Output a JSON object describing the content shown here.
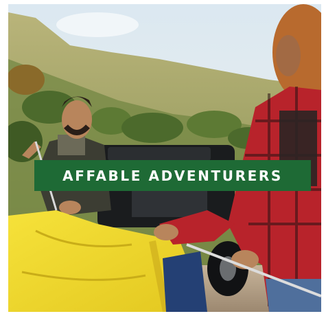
{
  "banner": {
    "label": "AFFABLE ADVENTURERS",
    "background": "#1e6a35",
    "text_color": "#ffffff"
  },
  "photo": {
    "subject": "friends-unpacking-camping-gear",
    "colors": {
      "sky": "#e4eef4",
      "hill": "#a8a464",
      "foliage": "#4c6a2c",
      "jeep": "#1a1c1e",
      "tent": "#f2dc30",
      "plaid": "#b8232b",
      "hair": "#b86a2e",
      "skin": "#b8855c"
    }
  }
}
